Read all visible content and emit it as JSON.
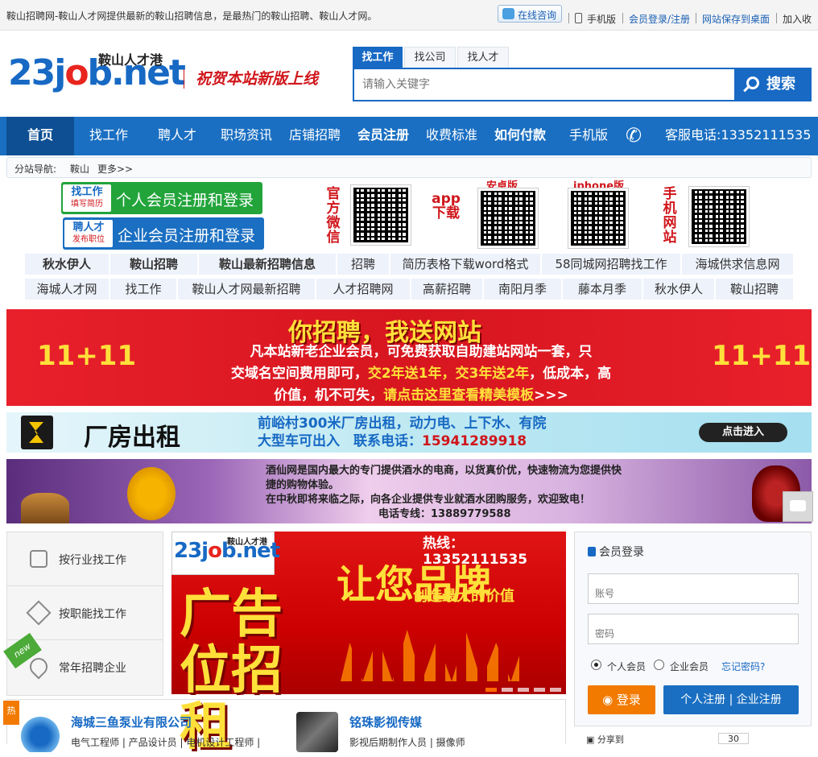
{
  "topbar": {
    "description": "鞍山招聘网-鞍山人才网提供最新的鞍山招聘信息，是最热门的鞍山招聘、鞍山人才网。",
    "consult": "在线咨询",
    "mobile": "手机版",
    "login_reg": "会员登录/注册",
    "save_desktop": "网站保存到桌面",
    "favorite": "加入收"
  },
  "header": {
    "logo_text": "23job.net",
    "logo_cn": "鞍山人才港",
    "slogan": "祝贺本站新版上线",
    "search_tabs": [
      "找工作",
      "找公司",
      "找人才"
    ],
    "search_placeholder": "请输入关键字",
    "search_button": "搜索"
  },
  "nav": {
    "items": [
      "首页",
      "找工作",
      "聘人才",
      "职场资讯",
      "店铺招聘",
      "会员注册",
      "收费标准",
      "如何付款",
      "手机版"
    ],
    "hotline": "客服电话:13352111535"
  },
  "branch": {
    "label": "分站导航:",
    "city": "鞍山",
    "more": "更多>>"
  },
  "promo": {
    "job_tag": "找工作",
    "job_tag_sub": "填写简历",
    "job_btn": "个人会员注册和登录",
    "hire_tag": "聘人才",
    "hire_tag_sub": "发布职位",
    "hire_btn": "企业会员注册和登录",
    "wechat_label": "官方微信",
    "app_label": "app下载",
    "android": "安卓版",
    "iphone": "iphone版",
    "mobile_label": "手机网站"
  },
  "keywords": {
    "row1": [
      "秋水伊人",
      "鞍山招聘",
      "鞍山最新招聘信息",
      "招聘",
      "简历表格下载word格式",
      "58同城网招聘找工作",
      "海城供求信息网"
    ],
    "row2": [
      "海城人才网",
      "找工作",
      "鞍山人才网最新招聘",
      "人才招聘网",
      "高薪招聘",
      "南阳月季",
      "藤本月季",
      "秋水伊人",
      "鞍山招聘"
    ]
  },
  "banner1": {
    "title": "你招聘，我送网站",
    "line1": "凡本站新老企业会员，可免费获取自助建站网站一套，只",
    "line2a": "交域名空间费用即可，",
    "line2b": "交2年送1年，交3年送2年",
    "line2c": "，低成本，高",
    "line3a": "价值，机不可失，",
    "line3b": "请点击这里查看精美模板",
    "line3c": ">>>",
    "badge": "11+11"
  },
  "banner2": {
    "title": "厂房出租",
    "line1": "前峪村300米厂房出租，动力电、上下水、有院",
    "line2": "大型车可出入　联系电话：",
    "phone": "15941289918",
    "button": "点击进入"
  },
  "banner3": {
    "line1": "酒仙网是国内最大的专门提供酒水的电商，以货真价优，快速物流为您提供快",
    "line2": "捷的购物体验。",
    "line3": "在中秋即将来临之际，向各企业提供专业就酒水团购服务，欢迎致电！",
    "line4": "电话专线：13889779588"
  },
  "left_menu": {
    "items": [
      "按行业找工作",
      "按职能找工作",
      "常年招聘企业"
    ],
    "badge": "new"
  },
  "center_ad": {
    "logo": "23job.net",
    "logo_cn": "鞍山人才港",
    "hotline": "热线：13352111535",
    "headline": "让您品牌",
    "sub": "创造最大的价值",
    "big": "广告位招租"
  },
  "login": {
    "title": "会员登录",
    "account_placeholder": "账号",
    "password_placeholder": "密码",
    "personal": "个人会员",
    "company": "企业会员",
    "forgot": "忘记密码?",
    "login_btn": "登录",
    "reg_btn": "个人注册 | 企业注册"
  },
  "companies": [
    {
      "name": "海城三鱼泵业有限公司",
      "jobs": "电气工程师 | 产品设计员 | 电机设计工程师 |"
    },
    {
      "name": "铭珠影视传媒",
      "jobs": "影视后期制作人员 | 摄像师"
    }
  ],
  "hot_badge": "热",
  "share": {
    "label": "分享到",
    "count": "30"
  }
}
